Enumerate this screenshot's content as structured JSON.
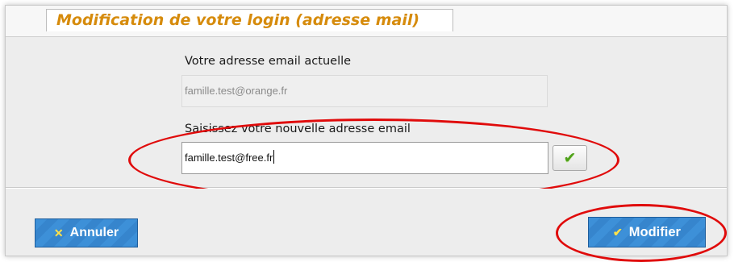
{
  "dialog": {
    "title": "Modification de votre login (adresse mail)"
  },
  "current_email": {
    "label": "Votre adresse email actuelle",
    "value": "famille.test@orange.fr"
  },
  "new_email": {
    "label": "Saisissez votre nouvelle adresse email",
    "value": "famille.test@free.fr",
    "validate_icon": "checkmark-icon"
  },
  "buttons": {
    "cancel_label": "Annuler",
    "cancel_icon": "x-icon",
    "modify_label": "Modifier",
    "modify_icon": "checkmark-icon"
  },
  "colors": {
    "title": "#d68b0c",
    "button": "#3d90d8",
    "highlight": "#e00b0b",
    "check": "#4fa11a"
  }
}
